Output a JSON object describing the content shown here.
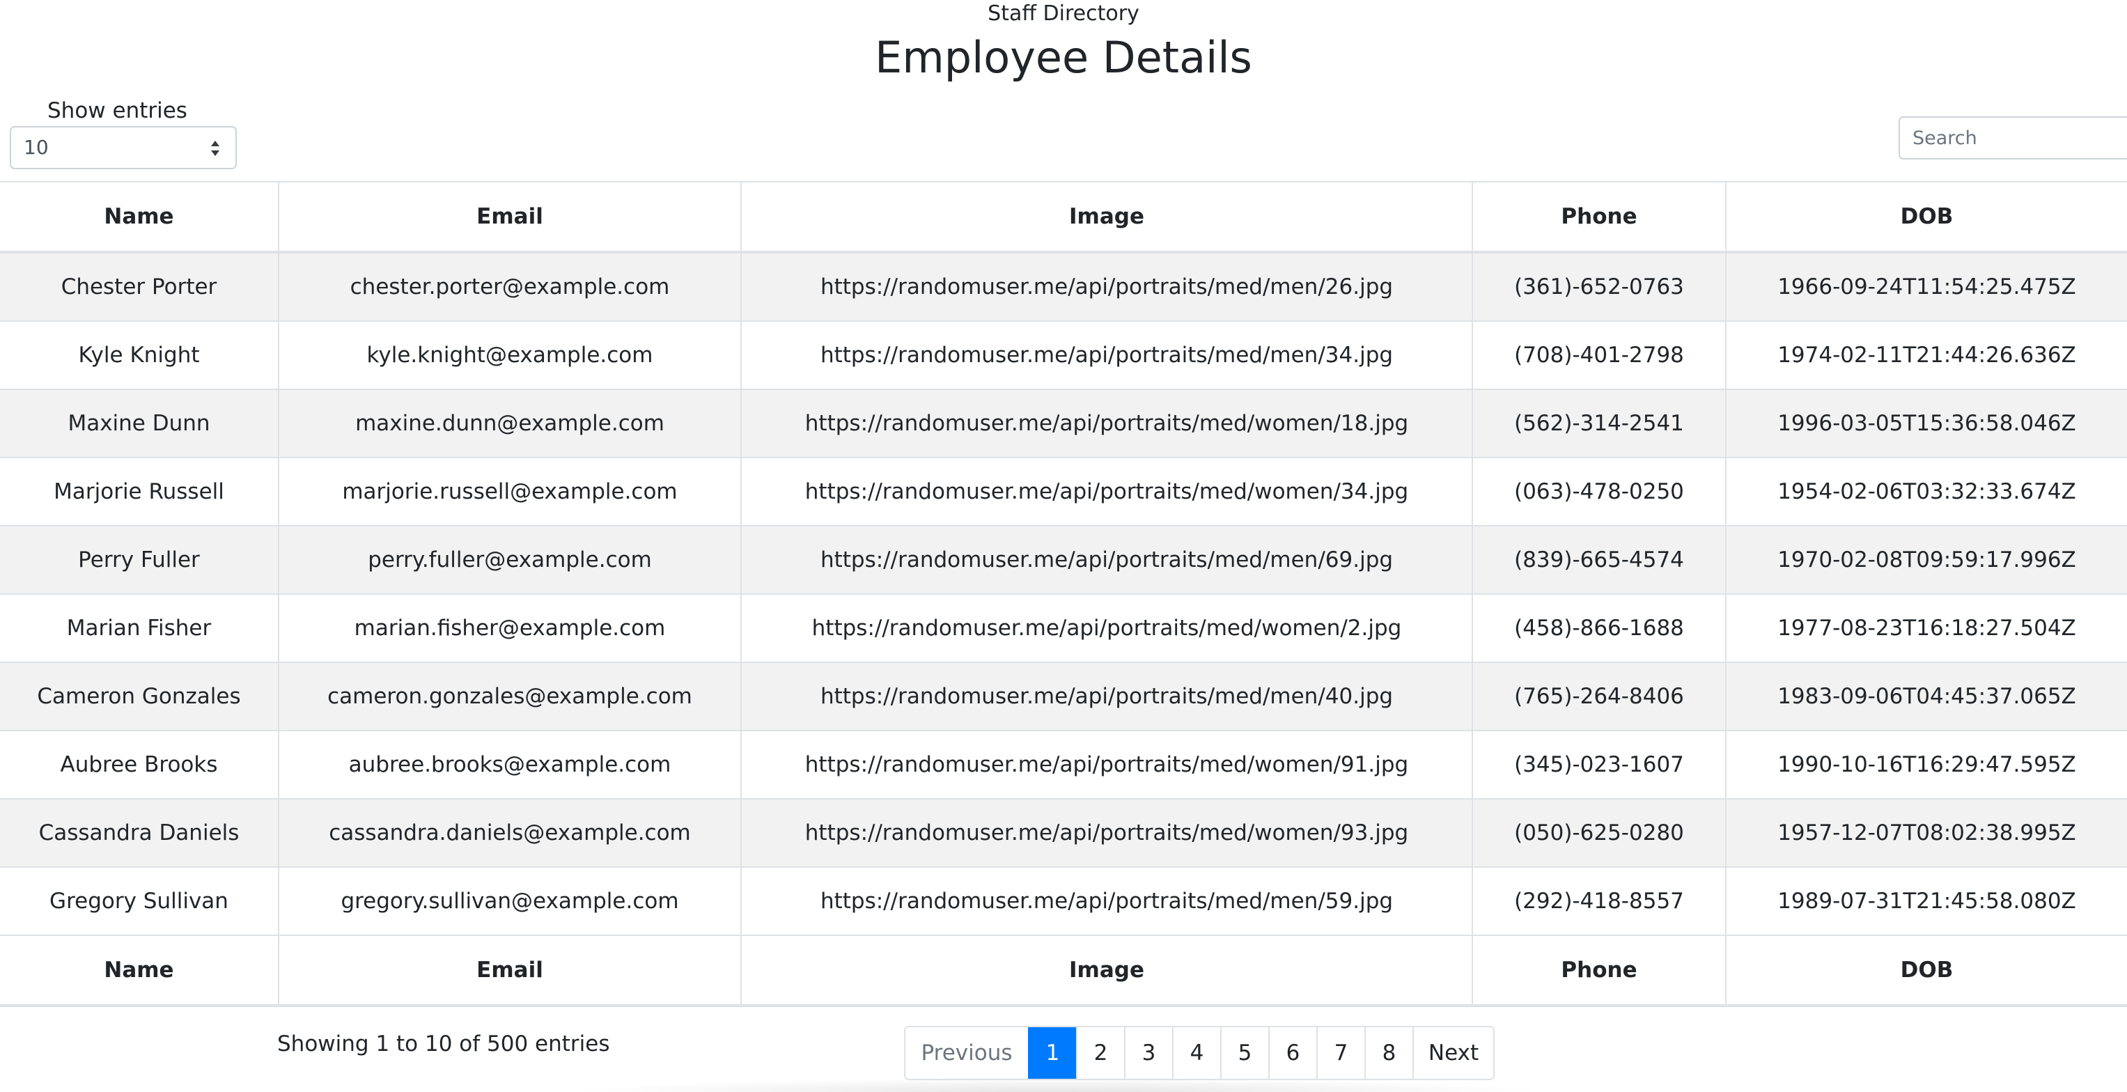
{
  "header": {
    "subtitle": "Staff Directory",
    "title": "Employee Details"
  },
  "controls": {
    "entries_label": "Show entries",
    "entries_value": "10",
    "search_placeholder": "Search"
  },
  "table": {
    "columns": [
      "Name",
      "Email",
      "Image",
      "Phone",
      "DOB"
    ],
    "rows": [
      [
        "Chester Porter",
        "chester.porter@example.com",
        "https://randomuser.me/api/portraits/med/men/26.jpg",
        "(361)-652-0763",
        "1966-09-24T11:54:25.475Z"
      ],
      [
        "Kyle Knight",
        "kyle.knight@example.com",
        "https://randomuser.me/api/portraits/med/men/34.jpg",
        "(708)-401-2798",
        "1974-02-11T21:44:26.636Z"
      ],
      [
        "Maxine Dunn",
        "maxine.dunn@example.com",
        "https://randomuser.me/api/portraits/med/women/18.jpg",
        "(562)-314-2541",
        "1996-03-05T15:36:58.046Z"
      ],
      [
        "Marjorie Russell",
        "marjorie.russell@example.com",
        "https://randomuser.me/api/portraits/med/women/34.jpg",
        "(063)-478-0250",
        "1954-02-06T03:32:33.674Z"
      ],
      [
        "Perry Fuller",
        "perry.fuller@example.com",
        "https://randomuser.me/api/portraits/med/men/69.jpg",
        "(839)-665-4574",
        "1970-02-08T09:59:17.996Z"
      ],
      [
        "Marian Fisher",
        "marian.fisher@example.com",
        "https://randomuser.me/api/portraits/med/women/2.jpg",
        "(458)-866-1688",
        "1977-08-23T16:18:27.504Z"
      ],
      [
        "Cameron Gonzales",
        "cameron.gonzales@example.com",
        "https://randomuser.me/api/portraits/med/men/40.jpg",
        "(765)-264-8406",
        "1983-09-06T04:45:37.065Z"
      ],
      [
        "Aubree Brooks",
        "aubree.brooks@example.com",
        "https://randomuser.me/api/portraits/med/women/91.jpg",
        "(345)-023-1607",
        "1990-10-16T16:29:47.595Z"
      ],
      [
        "Cassandra Daniels",
        "cassandra.daniels@example.com",
        "https://randomuser.me/api/portraits/med/women/93.jpg",
        "(050)-625-0280",
        "1957-12-07T08:02:38.995Z"
      ],
      [
        "Gregory Sullivan",
        "gregory.sullivan@example.com",
        "https://randomuser.me/api/portraits/med/men/59.jpg",
        "(292)-418-8557",
        "1989-07-31T21:45:58.080Z"
      ]
    ]
  },
  "footer": {
    "info": "Showing 1 to 10 of 500 entries",
    "pagination": {
      "previous": "Previous",
      "pages": [
        "1",
        "2",
        "3",
        "4",
        "5",
        "6",
        "7",
        "8"
      ],
      "active": "1",
      "next": "Next"
    }
  },
  "colors": {
    "accent": "#007bff",
    "stripe": "#f2f2f2",
    "border": "#dee2e6"
  }
}
